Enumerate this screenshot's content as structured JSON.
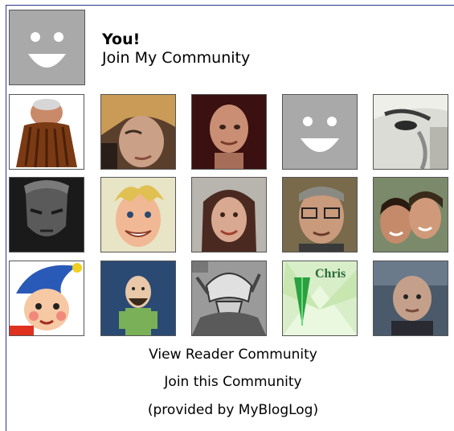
{
  "you": {
    "title": "You!",
    "subtitle": "Join My Community"
  },
  "members": [
    {
      "icon": "member-photo-upside-down"
    },
    {
      "icon": "member-photo-woman-blonde"
    },
    {
      "icon": "member-photo-bald-man"
    },
    {
      "icon": "member-default-smiley"
    },
    {
      "icon": "member-photo-man-closeup"
    },
    {
      "icon": "member-photo-cg-character"
    },
    {
      "icon": "member-photo-cartoon-blond-man"
    },
    {
      "icon": "member-photo-woman-smiling"
    },
    {
      "icon": "member-photo-man-glasses"
    },
    {
      "icon": "member-photo-couple"
    },
    {
      "icon": "member-photo-noddy-cartoon"
    },
    {
      "icon": "member-photo-cartoon-bearded-man"
    },
    {
      "icon": "member-photo-cartoon-football"
    },
    {
      "icon": "member-photo-chris-green"
    },
    {
      "icon": "member-photo-bald-man-dark"
    }
  ],
  "links": {
    "view": "View Reader Community",
    "join": "Join this Community",
    "provided": "(provided by MyBlogLog)"
  },
  "chris_tile_text": "Chris",
  "colors": {
    "frame": "#2a3a8c",
    "placeholder": "#a9a9a9"
  }
}
